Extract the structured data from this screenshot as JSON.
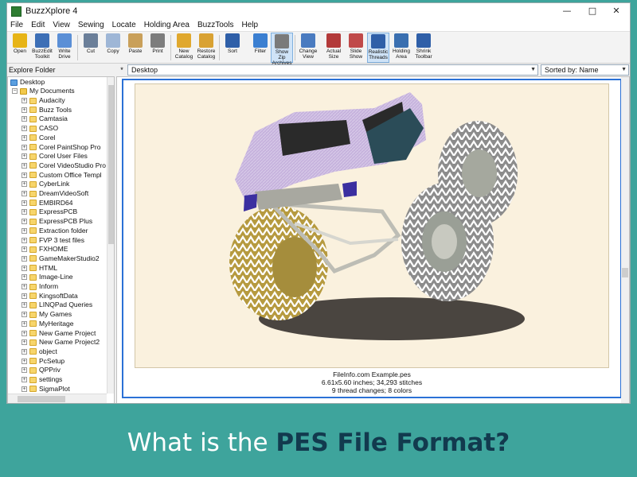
{
  "window": {
    "title": "BuzzXplore 4",
    "controls": {
      "minimize": "—",
      "maximize": "□",
      "close": "✕"
    }
  },
  "menu": [
    "File",
    "Edit",
    "View",
    "Sewing",
    "Locate",
    "Holding Area",
    "BuzzTools",
    "Help"
  ],
  "toolbar": {
    "buttons": [
      {
        "label": "Open",
        "icon": "open-folder-icon",
        "color": "#e7b416"
      },
      {
        "label": "BuzzEdit\nToolkit",
        "icon": "buzzedit-icon",
        "color": "#3d6fb6"
      },
      {
        "label": "Write\nDrive",
        "icon": "pen-icon",
        "color": "#5b8fd6"
      },
      {
        "label": "Cut",
        "icon": "scissors-icon",
        "color": "#6b7f99"
      },
      {
        "label": "Copy",
        "icon": "copy-icon",
        "color": "#9eb6d6"
      },
      {
        "label": "Paste",
        "icon": "paste-icon",
        "color": "#c9a05a"
      },
      {
        "label": "Print",
        "icon": "printer-icon",
        "color": "#7d7d7d"
      },
      {
        "label": "New\nCatalog",
        "icon": "new-catalog-icon",
        "color": "#e0a82e"
      },
      {
        "label": "Restore\nCatalog",
        "icon": "restore-catalog-icon",
        "color": "#d9a233"
      },
      {
        "label": "Sort",
        "icon": "sort-icon",
        "color": "#2f5fa8"
      },
      {
        "label": "Filter",
        "icon": "filter-icon",
        "color": "#3b7fd1"
      },
      {
        "label": "Show Zip\nArchives",
        "icon": "zip-icon",
        "color": "#7a7a7a",
        "active": true
      },
      {
        "label": "Change\nView",
        "icon": "change-view-icon",
        "color": "#4a7bc0"
      },
      {
        "label": "Actual\nSize",
        "icon": "actual-size-icon",
        "color": "#b33a3a"
      },
      {
        "label": "Slide\nShow",
        "icon": "slide-show-icon",
        "color": "#c04a4a"
      },
      {
        "label": "Realistic\nThreads",
        "icon": "realistic-threads-icon",
        "color": "#2f5fa8",
        "active": true
      },
      {
        "label": "Holding\nArea",
        "icon": "holding-area-icon",
        "color": "#3a6fb0"
      },
      {
        "label": "Shrink\nToolbar",
        "icon": "shrink-toolbar-icon",
        "color": "#2f5fa8"
      }
    ]
  },
  "explorer": {
    "label": "Explore Folder",
    "root": "Desktop",
    "parent": "My Documents",
    "items": [
      "Audacity",
      "Buzz Tools",
      "Camtasia",
      "CASO",
      "Corel",
      "Corel PaintShop Pro",
      "Corel User Files",
      "Corel VideoStudio Pro",
      "Custom Office Templ",
      "CyberLink",
      "DreamVideoSoft",
      "EMBIRD64",
      "ExpressPCB",
      "ExpressPCB Plus",
      "Extraction folder",
      "FVP 3 test files",
      "FXHOME",
      "GameMakerStudio2",
      "HTML",
      "Image-Line",
      "Inform",
      "KingsoftData",
      "LINQPad Queries",
      "My Games",
      "MyHeritage",
      "New Game Project",
      "New Game Project2",
      "object",
      "PcSetup",
      "QPPriv",
      "settings",
      "SigmaPlot"
    ]
  },
  "pathbar": {
    "star": "*",
    "path": "Desktop",
    "sort": "Sorted by: Name"
  },
  "preview": {
    "filename": "FileInfo.com Example.pes",
    "dimensions": "6.61x5.60 inches; 34,293 stitches",
    "colors": "9 thread changes; 8 colors"
  },
  "banner": {
    "prefix": "What is the ",
    "emphasis": "PES File Format?"
  }
}
